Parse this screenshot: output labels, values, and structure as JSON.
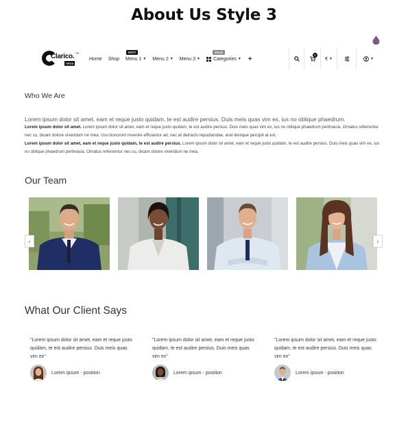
{
  "page_title": "About Us Style 3",
  "colors": {
    "accent_drop": "#7d5a8c",
    "dark": "#111111",
    "text": "#333333"
  },
  "header": {
    "logo_text": "Clarico.",
    "logo_tm": "TM",
    "logo_badge": "VEGA",
    "nav": [
      {
        "label": "Home"
      },
      {
        "label": "Shop"
      },
      {
        "label": "Menu 1",
        "tag": "HOT!"
      },
      {
        "label": "Menu 2"
      },
      {
        "label": "Menu 3"
      },
      {
        "label": "Categories",
        "tag": "SALE"
      }
    ],
    "cart_count": "0",
    "currency": "€",
    "icons": [
      "search-icon",
      "cart-icon",
      "filter-icon",
      "user-icon",
      "plus-icon"
    ]
  },
  "who": {
    "title": "Who We Are",
    "lead": "Lorem ipsum dolor sit amet, eam et reque justo quidam, te est audire persius. Duis meis quas vim ex, ius no oblique phaedrum.",
    "p1_bold": "Lorem ipsum dolor sit amet.",
    "p1_text": " Lorem ipsum dolor sit amet, eam et reque justo quidam, te est audire persius. Duis meis quas vim ex, ius no oblique phaedrum pertinacia. Ornatus referrentur nec cu, dicam dolore vivendum ne mea. Usu bonorum invenire efficiantur ad, nec at detracto repudiandae, erat denique percipit at est.",
    "p2_bold": "Lorem ipsum dolor sit amet, eam et reque justo quidam, te est audire persius.",
    "p2_text": " Lorem ipsum dolor sit amet, eam et reque justo quidam, te est audire persius. Duis meis quas vim ex, ius no oblique phaedrum pertinacia. Ornatus referrentur nec cu, dicam dolore vivendum ne mea,"
  },
  "team": {
    "title": "Our Team",
    "prev": "‹",
    "next": "›"
  },
  "clients": {
    "title": "What Our Client Says",
    "items": [
      {
        "quote": "\"Lorem ipsum dolor sit amet, eam et reque justo quidam, te est audire persius. Duis meis quas vim ex\"",
        "name": "Lorem ipsum - position"
      },
      {
        "quote": "\"Lorem ipsum dolor sit amet, eam et reque justo quidam, te est audire persius. Duis meis quas vim ex\"",
        "name": "Lorem ipsum - position"
      },
      {
        "quote": "\"Lorem ipsum dolor sit amet, eam et reque justo quidam, te est audire persius. Duis meis quas vim ex\"",
        "name": "Lorem ipsum - position"
      }
    ]
  }
}
